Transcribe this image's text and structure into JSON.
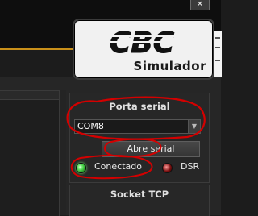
{
  "window": {
    "close_glyph": "✕"
  },
  "logo": {
    "main_text": "CBC",
    "sub_text": "Simulador"
  },
  "serial": {
    "title": "Porta serial",
    "port_value": "COM8",
    "open_button_label": "Abre serial",
    "status_label": "Conectado",
    "dsr_label": "DSR",
    "status_led_color": "#4cd84c",
    "dsr_led_color": "#7a1010"
  },
  "tcp": {
    "title": "Socket TCP"
  },
  "icons": {
    "dropdown": "chevron-down-icon"
  }
}
